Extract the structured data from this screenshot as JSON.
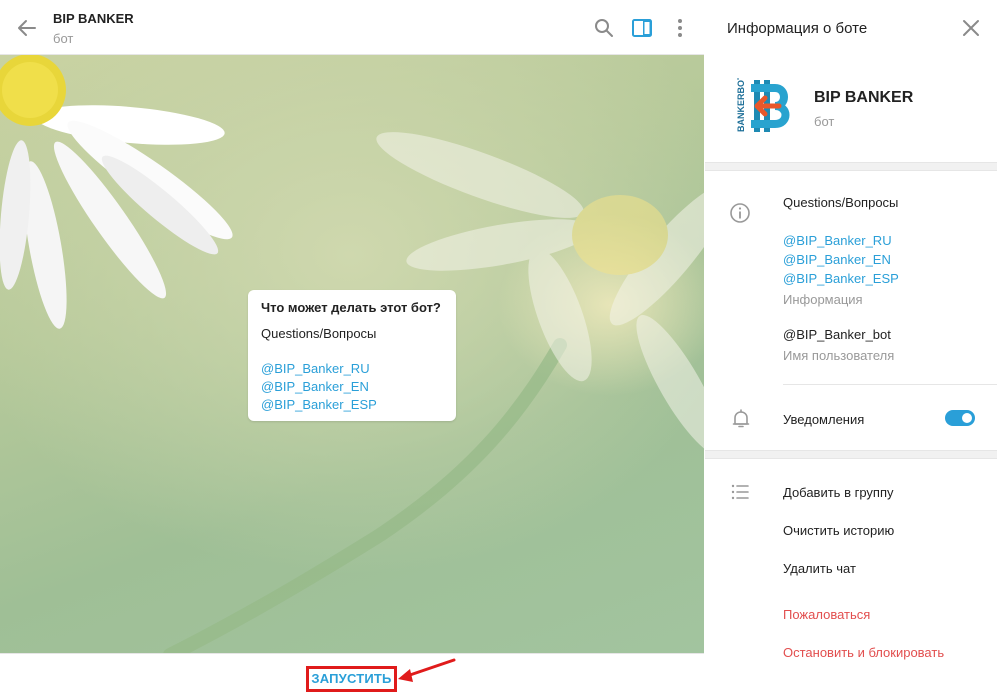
{
  "chat": {
    "title": "BIP BANKER",
    "subtitle": "бот"
  },
  "bot_card": {
    "title": "Что может делать этот бот?",
    "description": "Questions/Вопросы",
    "links": [
      "@BIP_Banker_RU",
      "@BIP_Banker_EN",
      "@BIP_Banker_ESP"
    ]
  },
  "footer": {
    "start_label": "ЗАПУСТИТЬ"
  },
  "panel": {
    "title": "Информация о боте",
    "bot_name": "BIP BANKER",
    "bot_type": "бот",
    "logo_text": "BANKERBOT",
    "info": {
      "description": "Questions/Вопросы",
      "links": [
        "@BIP_Banker_RU",
        "@BIP_Banker_EN",
        "@BIP_Banker_ESP"
      ],
      "description_label": "Информация",
      "username": "@BIP_Banker_bot",
      "username_label": "Имя пользователя"
    },
    "notifications": {
      "label": "Уведомления",
      "enabled": true
    },
    "actions": {
      "add_to_group": "Добавить в группу",
      "clear_history": "Очистить историю",
      "delete_chat": "Удалить чат",
      "report": "Пожаловаться",
      "stop_block": "Остановить и блокировать"
    }
  },
  "icons": {
    "back": "arrow-left-icon",
    "search": "search-icon",
    "sidebar_toggle": "sidebar-panel-icon",
    "more": "more-vertical-icon",
    "close": "close-icon",
    "info": "info-icon",
    "bell": "bell-icon",
    "list": "list-icon"
  },
  "colors": {
    "accent": "#2a9fd8",
    "danger": "#e24e4e",
    "annotation": "#e01b1b"
  }
}
